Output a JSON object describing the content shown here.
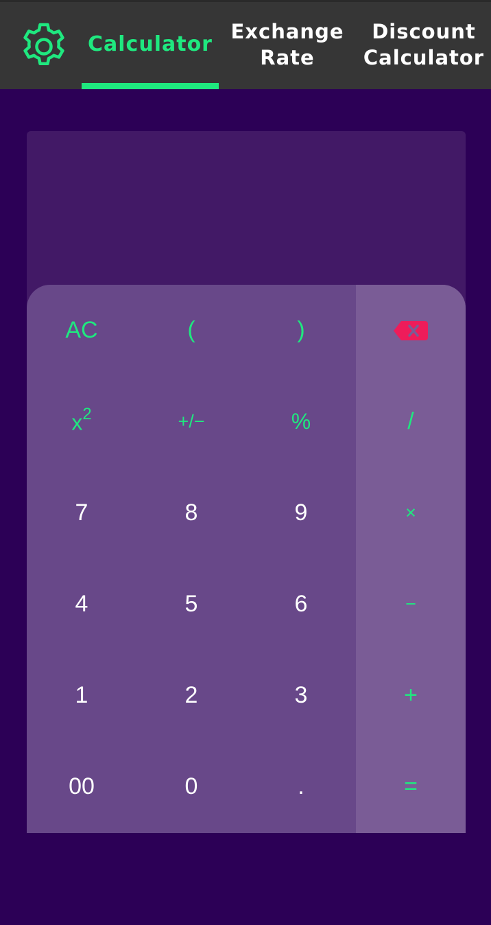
{
  "header": {
    "tabs": [
      {
        "label_lines": [
          "Calculator"
        ]
      },
      {
        "label_lines": [
          "Exchange",
          "Rate"
        ]
      },
      {
        "label_lines": [
          "Discount",
          "Calculator"
        ]
      }
    ],
    "active_tab": "Calculator"
  },
  "display": {
    "expression": "",
    "result": ""
  },
  "keypad": {
    "row1": [
      "AC",
      "(",
      ")"
    ],
    "row2": [
      "x",
      "+/−",
      "%",
      "/"
    ],
    "square_exponent": "2",
    "row3": [
      "7",
      "8",
      "9",
      "×"
    ],
    "row4": [
      "4",
      "5",
      "6",
      "−"
    ],
    "row5": [
      "1",
      "2",
      "3",
      "+"
    ],
    "row6": [
      "00",
      "0",
      ".",
      "="
    ]
  },
  "colors": {
    "background": "#2c0056",
    "header": "#363636",
    "accent": "#1fe87f",
    "display": "#421966",
    "keypad": "#684889",
    "operator_column": "#7a5c96",
    "backspace": "#ee1c5a"
  },
  "icons": {
    "settings": "gear-icon",
    "backspace": "backspace-icon"
  }
}
